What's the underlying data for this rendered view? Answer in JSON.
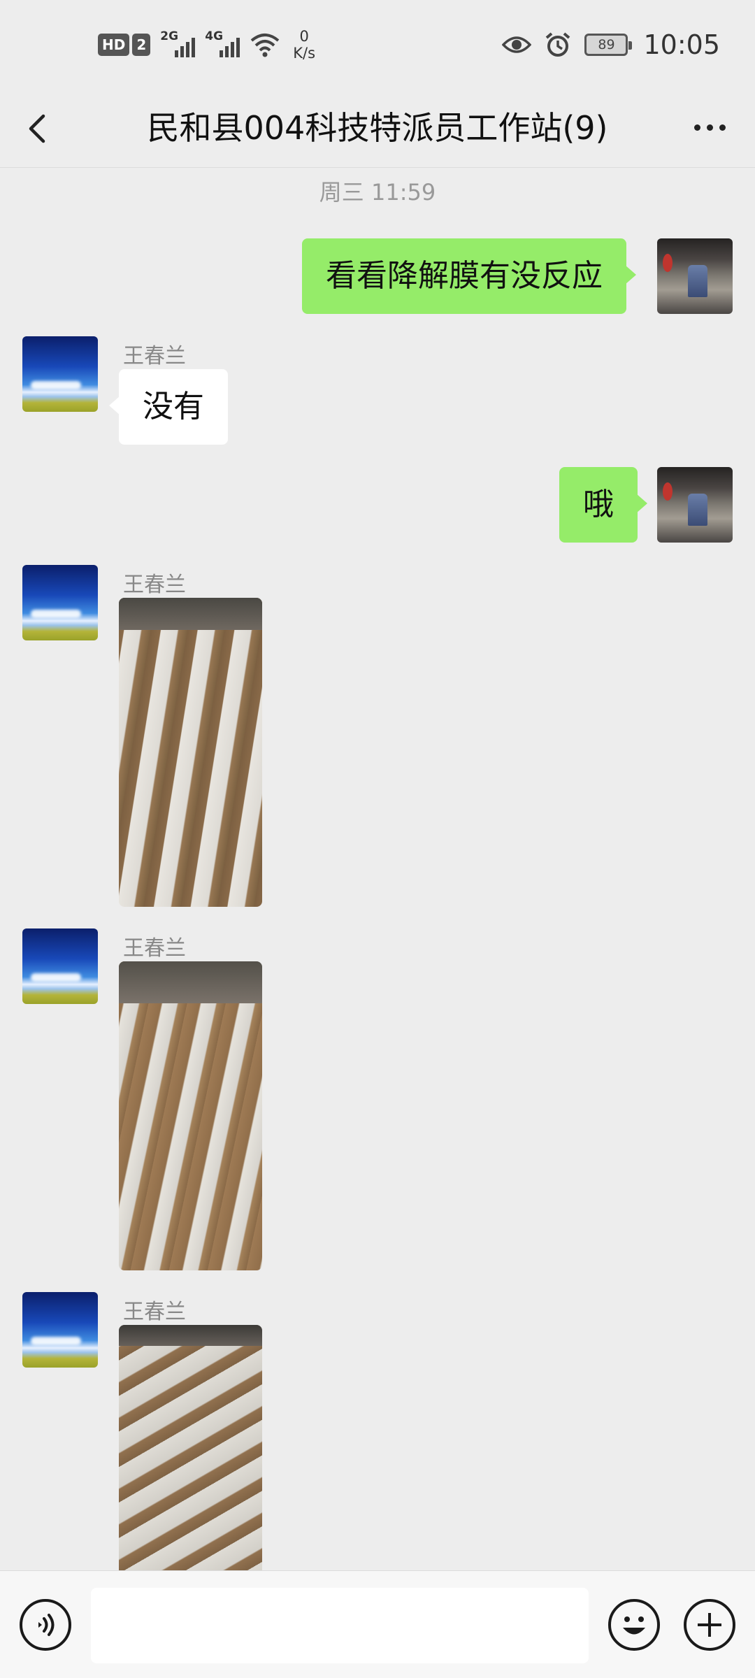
{
  "status_bar": {
    "hd_label": "HD",
    "sim_label": "2",
    "signal_1_label": "2G",
    "signal_2_label": "4G",
    "net_speed_value": "0",
    "net_speed_unit": "K/s",
    "battery_level": "89",
    "time": "10:05",
    "icons": [
      "wifi-icon",
      "eye-icon",
      "alarm-icon",
      "battery-icon"
    ]
  },
  "nav": {
    "title": "民和县004科技特派员工作站(9)",
    "icons": [
      "back-icon",
      "more-icon"
    ]
  },
  "chat": {
    "timestamp": "周三 11:59",
    "messages": [
      {
        "direction": "out",
        "type": "text",
        "text": "看看降解膜有没反应"
      },
      {
        "direction": "in",
        "type": "text",
        "sender": "王春兰",
        "text": "没有"
      },
      {
        "direction": "out",
        "type": "text",
        "text": "哦"
      },
      {
        "direction": "in",
        "type": "image",
        "sender": "王春兰"
      },
      {
        "direction": "in",
        "type": "image",
        "sender": "王春兰"
      },
      {
        "direction": "in",
        "type": "image",
        "sender": "王春兰"
      }
    ]
  },
  "input_bar": {
    "message_value": "",
    "icons": [
      "voice-icon",
      "emoji-icon",
      "plus-icon"
    ]
  },
  "colors": {
    "background": "#ededed",
    "outgoing_bubble": "#95ec69",
    "incoming_bubble": "#ffffff",
    "name_text": "#888888"
  }
}
